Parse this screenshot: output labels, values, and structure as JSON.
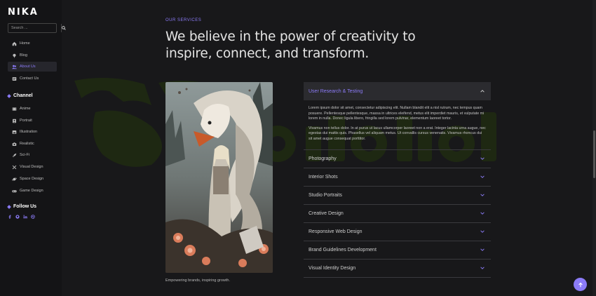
{
  "brand": {
    "logo": "NIKA"
  },
  "search": {
    "placeholder": "Search ..."
  },
  "nav": [
    {
      "label": "Home",
      "icon": "home-icon"
    },
    {
      "label": "Blog",
      "icon": "pin-icon"
    },
    {
      "label": "About Us",
      "icon": "users-icon",
      "active": true
    },
    {
      "label": "Contact Us",
      "icon": "contact-icon"
    }
  ],
  "channel": {
    "title": "Channel",
    "items": [
      {
        "label": "Anime",
        "icon": "film-icon"
      },
      {
        "label": "Portrait",
        "icon": "portrait-icon"
      },
      {
        "label": "Illustration",
        "icon": "image-icon"
      },
      {
        "label": "Realistic",
        "icon": "camera-icon"
      },
      {
        "label": "Sci-Fi",
        "icon": "rocket-icon"
      },
      {
        "label": "Visual Design",
        "icon": "tools-icon"
      },
      {
        "label": "Space Design",
        "icon": "planet-icon"
      },
      {
        "label": "Game Design",
        "icon": "gamepad-icon"
      }
    ]
  },
  "follow": {
    "title": "Follow Us",
    "icons": [
      "facebook-icon",
      "github-icon",
      "linkedin-icon",
      "dribbble-icon"
    ]
  },
  "hero": {
    "eyebrow": "OUR SERVICES",
    "headline": "We believe in the power of creativity to inspire, connect, and transform."
  },
  "image": {
    "caption": "Empowering brands, inspiring growth."
  },
  "accordion": {
    "open": {
      "title": "User Research & Testing",
      "paragraphs": [
        "Lorem ipsum dolor sit amet, consectetur adipiscing elit. Nullam blandit elit a nisl rutrum, nec tempus quam posuere. Pellentesque pellentesque, massa in ultrices eleifend, metus elit imperdiet mauris, et vulputate mi lorem in nulla. Donec ligula libero, fringilla sed lorem pulvinar, elementum laoreet tortor.",
        "Vivamus non tellus dolor. In at purus ut lacus ullamcorper laoreet non a erat. Integer lacinia urna augue, nec egestas dui mattis quis. Phasellus vel aliquam metus. Ut convallis cursus venenatis. Vivamus rhoncus dui sit amet augue consequat porttitor."
      ]
    },
    "items": [
      "Photography",
      "Interior Shots",
      "Studio Portraits",
      "Creative Design",
      "Responsive Web Design",
      "Brand Guidelines Development",
      "Visual Identity Design"
    ]
  },
  "colors": {
    "accent": "#8b7bf7",
    "background": "#18181a",
    "sidebar": "#141416"
  }
}
